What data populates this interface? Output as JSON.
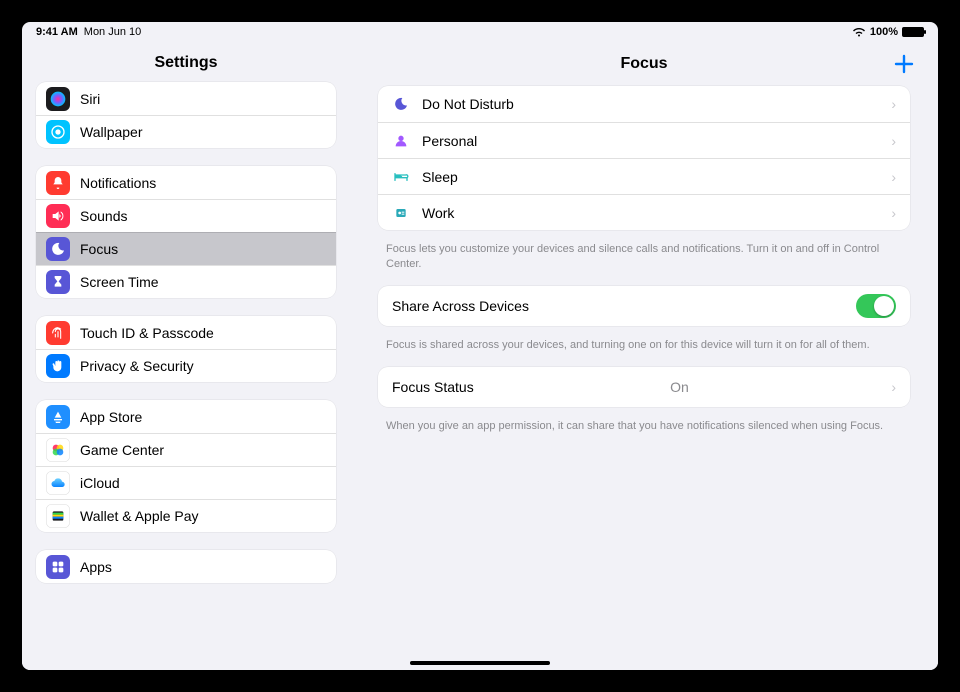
{
  "status": {
    "time": "9:41 AM",
    "date": "Mon Jun 10",
    "battery": "100%"
  },
  "sidebar": {
    "title": "Settings",
    "groups": [
      [
        {
          "label": "Siri",
          "icon": "siri",
          "color": "#1c1c1e"
        },
        {
          "label": "Wallpaper",
          "icon": "wallpaper",
          "color": "#00c3ff"
        }
      ],
      [
        {
          "label": "Notifications",
          "icon": "bell",
          "color": "#ff3b30"
        },
        {
          "label": "Sounds",
          "icon": "speaker",
          "color": "#ff2d55"
        },
        {
          "label": "Focus",
          "icon": "moon",
          "color": "#5856d6",
          "selected": true
        },
        {
          "label": "Screen Time",
          "icon": "hourglass",
          "color": "#5856d6"
        }
      ],
      [
        {
          "label": "Touch ID & Passcode",
          "icon": "fingerprint",
          "color": "#ff3b30"
        },
        {
          "label": "Privacy & Security",
          "icon": "hand",
          "color": "#007aff"
        }
      ],
      [
        {
          "label": "App Store",
          "icon": "appstore",
          "color": "#1f8fff"
        },
        {
          "label": "Game Center",
          "icon": "gamecenter",
          "color": "#ffffff"
        },
        {
          "label": "iCloud",
          "icon": "cloud",
          "color": "#ffffff"
        },
        {
          "label": "Wallet & Apple Pay",
          "icon": "wallet",
          "color": "#ffffff"
        }
      ],
      [
        {
          "label": "Apps",
          "icon": "grid",
          "color": "#5856d6"
        }
      ]
    ]
  },
  "main": {
    "title": "Focus",
    "add_label": "+",
    "modes": [
      {
        "label": "Do Not Disturb",
        "icon": "moon",
        "color": "#5856d6"
      },
      {
        "label": "Personal",
        "icon": "person",
        "color": "#a259ff"
      },
      {
        "label": "Sleep",
        "icon": "bed",
        "color": "#28bfbf"
      },
      {
        "label": "Work",
        "icon": "badge",
        "color": "#2aa9b8"
      }
    ],
    "modes_footer": "Focus lets you customize your devices and silence calls and notifications. Turn it on and off in Control Center.",
    "share": {
      "label": "Share Across Devices",
      "on": true
    },
    "share_footer": "Focus is shared across your devices, and turning one on for this device will turn it on for all of them.",
    "status": {
      "label": "Focus Status",
      "value": "On"
    },
    "status_footer": "When you give an app permission, it can share that you have notifications silenced when using Focus."
  }
}
